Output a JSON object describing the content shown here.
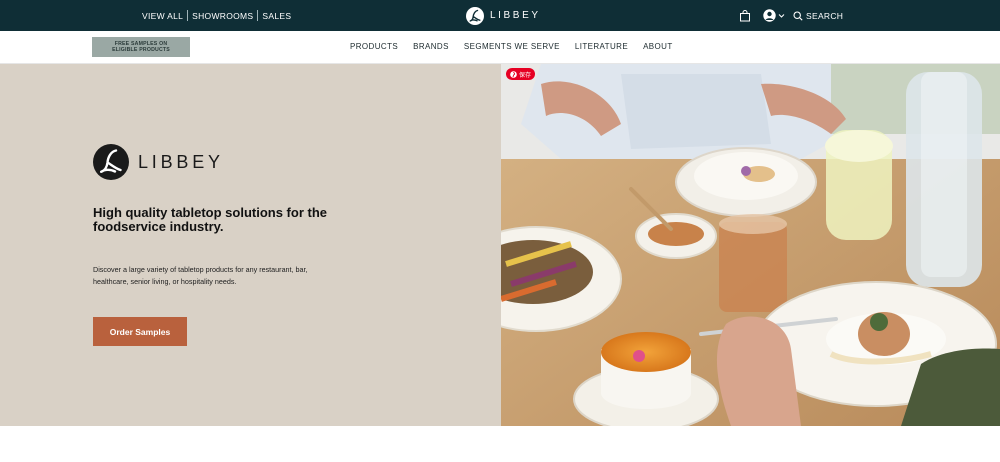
{
  "topbar": {
    "links": [
      "VIEW ALL",
      "SHOWROOMS",
      "SALES"
    ],
    "logo_text": "LIBBEY",
    "search_label": "SEARCH"
  },
  "promo": {
    "line1": "FREE SAMPLES ON",
    "line2": "ELIGIBLE PRODUCTS"
  },
  "nav": {
    "items": [
      "PRODUCTS",
      "BRANDS",
      "SEGMENTS WE SERVE",
      "LITERATURE",
      "ABOUT"
    ]
  },
  "hero": {
    "brand_text": "LIBBEY",
    "headline": "High quality tabletop solutions for the foodservice industry.",
    "description": "Discover a large variety of tabletop products for any restaurant, bar, healthcare, senior living, or hospitality needs.",
    "cta_label": "Order Samples",
    "pin_label": "保存"
  },
  "colors": {
    "topbar": "#0f2e36",
    "hero_left_bg": "#d9d1c6",
    "cta": "#b9613d",
    "promo_bg": "#9aa8a4"
  }
}
